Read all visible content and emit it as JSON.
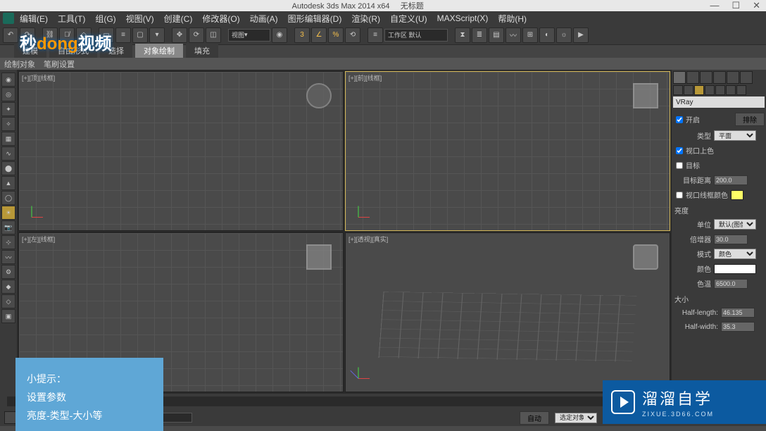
{
  "title": {
    "app": "Autodesk 3ds Max  2014 x64",
    "doc": "无标题"
  },
  "menu": {
    "edit": "编辑(E)",
    "tools": "工具(T)",
    "group": "组(G)",
    "views": "视图(V)",
    "create": "创建(C)",
    "modifiers": "修改器(O)",
    "animation": "动画(A)",
    "grapheditors": "图形编辑器(D)",
    "rendering": "渲染(R)",
    "customize": "自定义(U)",
    "maxscript": "MAXScript(X)",
    "help": "帮助(H)"
  },
  "toolbar": {
    "viewDropdown": "视图",
    "presetDropdown": "工作区 默认"
  },
  "ribbon": {
    "tabs": {
      "model": "建模",
      "freeform": "自由形式",
      "select": "选择",
      "objpaint": "对象绘制",
      "fill": "填充"
    },
    "sub": {
      "drawobj": "绘制对象",
      "brush": "笔刷设置"
    }
  },
  "viewports": {
    "tl": "[+][顶][线框]",
    "tr": "[+][前][线框]",
    "bl": "[+][左][线框]",
    "br": "[+][透视][真实]"
  },
  "panel": {
    "renderer": "VRay",
    "enable": "开启",
    "exclude_btn": "排除",
    "type_label": "类型",
    "type_val": "平面",
    "viewportShade": "视口上色",
    "target": "目标",
    "targetDist_label": "目标距离",
    "targetDist_val": "200.0",
    "vpWireColor": "视口线框颜色",
    "section_brightness": "亮度",
    "units_label": "单位",
    "units_val": "默认(图像)",
    "mult_label": "倍增器",
    "mult_val": "30.0",
    "mode_label": "模式",
    "mode_val": "颜色",
    "color_label": "颜色",
    "temp_label": "色温",
    "temp_val": "6500.0",
    "section_size": "大小",
    "halfL_label": "Half-length:",
    "halfL_val": "46.135",
    "halfW_label": "Half-width:",
    "halfW_val": "35.3"
  },
  "status": {
    "slider_set": "自动",
    "selected": "选定对象"
  },
  "overlays": {
    "watermark_a": "秒",
    "watermark_b": "dong",
    "watermark_c": "视频",
    "tip1": "小提示：",
    "tip2": "设置参数",
    "tip3": "亮度-类型-大小等",
    "zixue": "溜溜自学",
    "zixue_url": "ZIXUE.3D66.COM"
  }
}
